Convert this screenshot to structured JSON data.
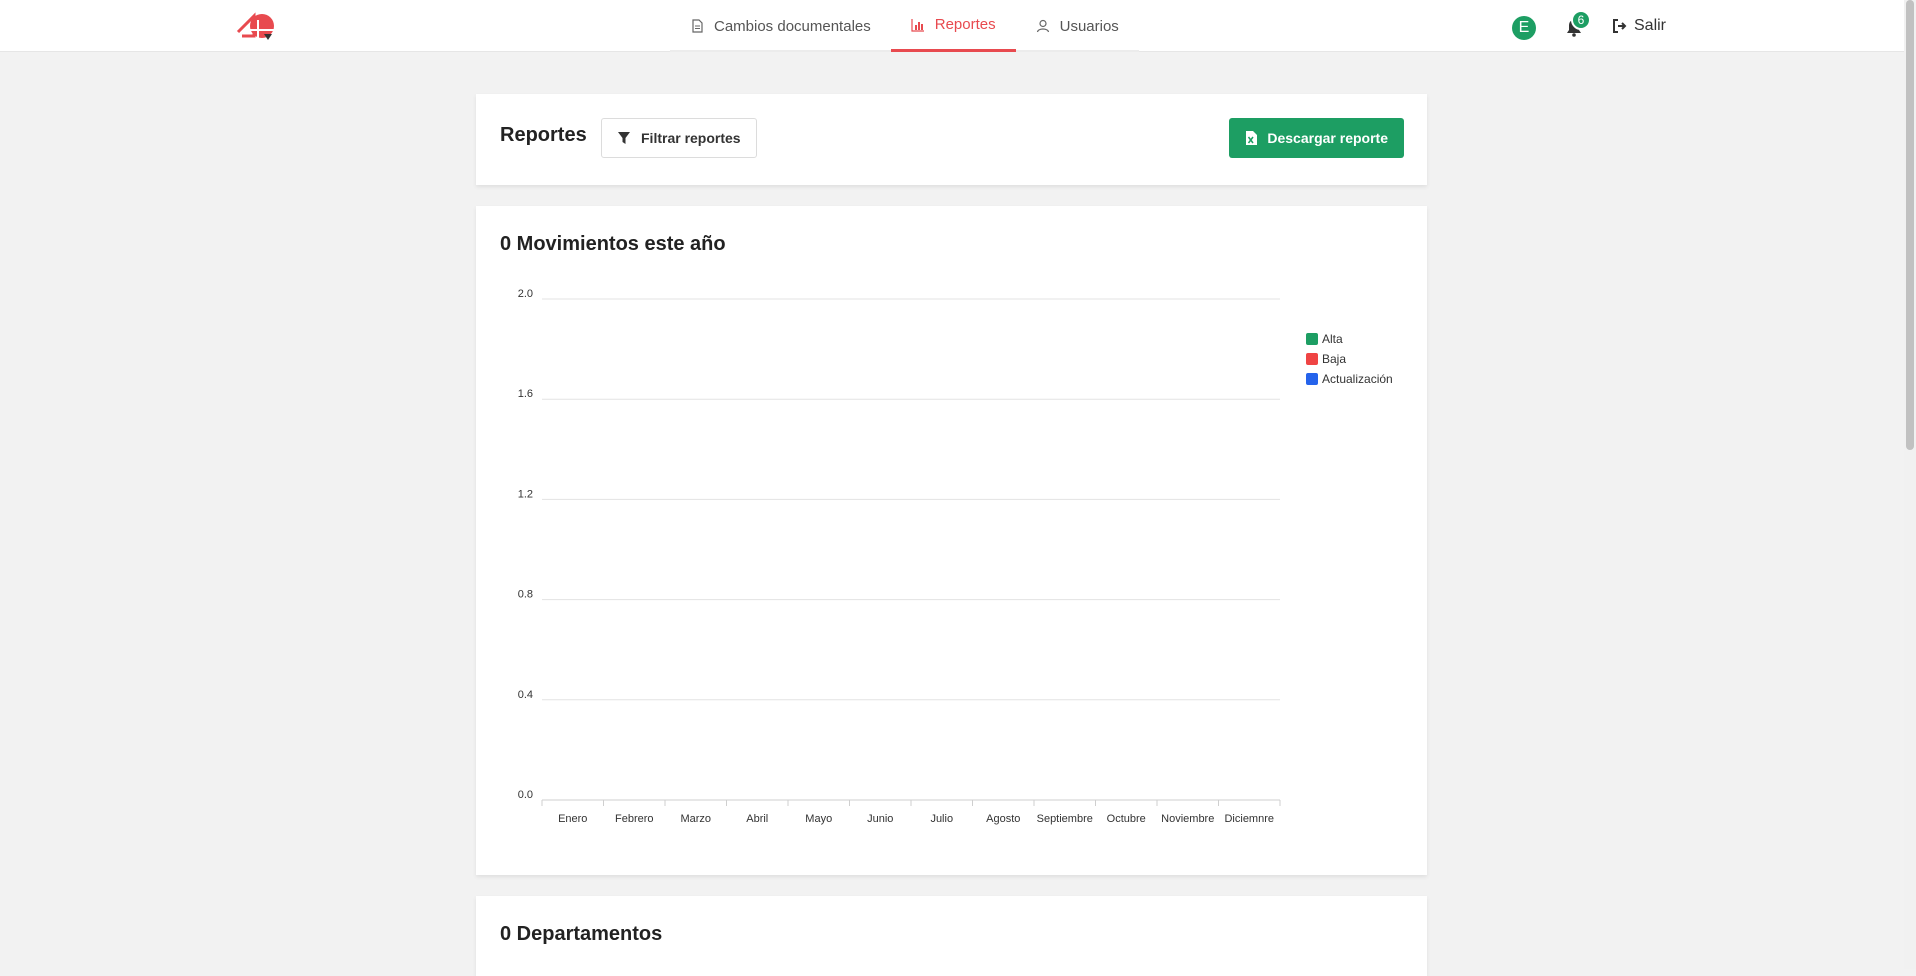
{
  "nav": {
    "tabs": [
      {
        "label": "Cambios documentales",
        "icon": "document-icon",
        "active": false
      },
      {
        "label": "Reportes",
        "icon": "bar-chart-icon",
        "active": true
      },
      {
        "label": "Usuarios",
        "icon": "user-icon",
        "active": false
      }
    ],
    "avatar_initial": "E",
    "notification_count": "6",
    "logout_label": "Salir"
  },
  "header_card": {
    "title": "Reportes",
    "filter_label": "Filtrar reportes",
    "download_label": "Descargar reporte"
  },
  "chart_section": {
    "title": "0 Movimientos este año"
  },
  "dept_section": {
    "title": "0 Departamentos"
  },
  "colors": {
    "accent_red": "#e84a4f",
    "brand_green": "#1d9e63",
    "alta": "#1d9e63",
    "baja": "#ef4444",
    "actualizacion": "#2563eb"
  },
  "chart_data": {
    "type": "bar",
    "categories": [
      "Enero",
      "Febrero",
      "Marzo",
      "Abril",
      "Mayo",
      "Junio",
      "Julio",
      "Agosto",
      "Septiembre",
      "Octubre",
      "Noviembre",
      "Diciemnre"
    ],
    "series": [
      {
        "name": "Alta",
        "values": [
          0,
          0,
          0,
          0,
          0,
          0,
          0,
          0,
          0,
          0,
          0,
          0
        ]
      },
      {
        "name": "Baja",
        "values": [
          0,
          0,
          0,
          0,
          0,
          0,
          0,
          0,
          0,
          0,
          0,
          0
        ]
      },
      {
        "name": "Actualización",
        "values": [
          0,
          0,
          0,
          0,
          0,
          0,
          0,
          0,
          0,
          0,
          0,
          0
        ]
      }
    ],
    "yticks": [
      "0.0",
      "0.4",
      "0.8",
      "1.2",
      "1.6",
      "2.0"
    ],
    "ylim": [
      0,
      2
    ],
    "grid": true,
    "legend_position": "right"
  }
}
